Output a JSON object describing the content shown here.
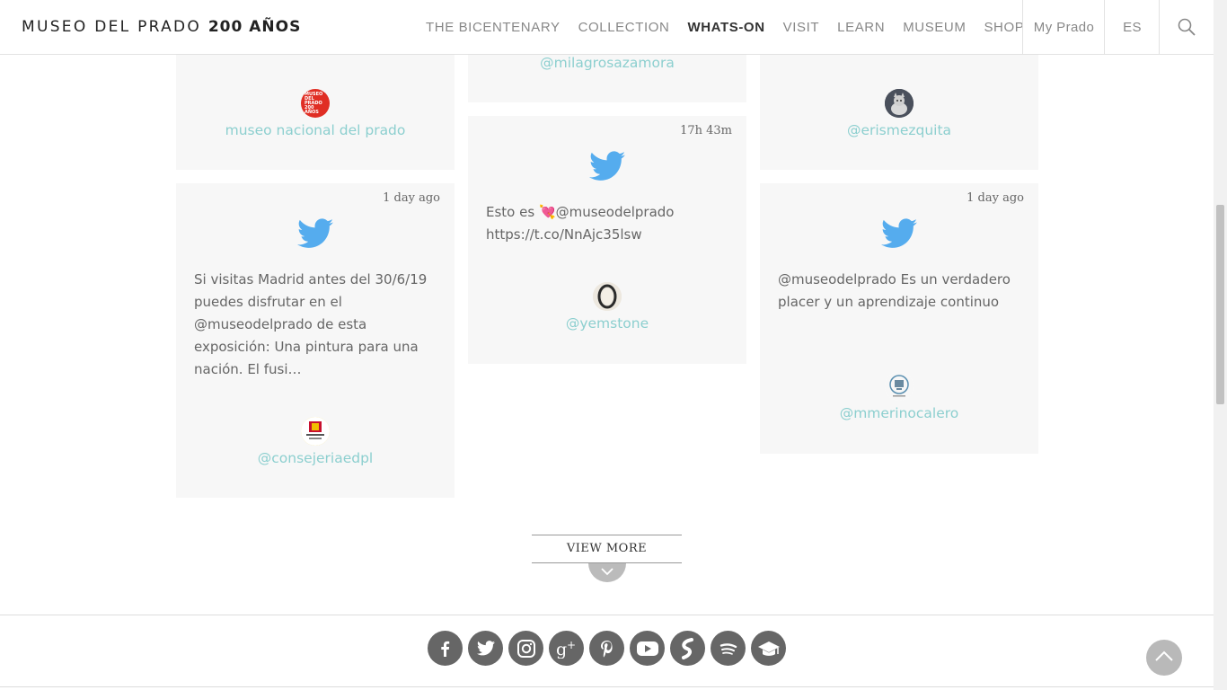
{
  "header": {
    "logo_text": "MUSEO DEL PRADO",
    "logo_bold": "200 AÑOS",
    "nav": [
      "THE BICENTENARY",
      "COLLECTION",
      "WHATS-ON",
      "VISIT",
      "LEARN",
      "MUSEUM",
      "SHOP"
    ],
    "active_nav": "WHATS-ON",
    "my_prado": "My Prado",
    "language": "ES"
  },
  "cards": {
    "c1": {
      "handle": "museo nacional del prado",
      "avatar_text": "MUSEO DEL PRADO 200 AÑOS"
    },
    "c2": {
      "handle": "@milagrosazamora"
    },
    "c3": {
      "handle": "@erismezquita"
    },
    "c4": {
      "time": "1 day ago",
      "text": "Si visitas Madrid antes del 30/6/19 puedes disfrutar en el @museodelprado de esta exposición: Una pintura para una nación. El fusi…",
      "handle": "@consejeriaedpl"
    },
    "c5": {
      "time": "17h 43m",
      "text_prefix": "Esto es ",
      "text_emoji": "💘",
      "text_rest": "@museodelprado https://t.co/NnAjc35lsw",
      "handle": "@yemstone"
    },
    "c6": {
      "time": "1 day ago",
      "text": "@museodelprado Es un verdadero placer y un aprendizaje continuo",
      "handle": "@mmerinocalero"
    }
  },
  "view_more": "VIEW MORE",
  "social_icons": [
    "facebook-icon",
    "twitter-icon",
    "instagram-icon",
    "google-plus-icon",
    "pinterest-icon",
    "youtube-icon",
    "soundcloud-icon",
    "spotify-icon",
    "education-icon"
  ],
  "colors": {
    "handle": "#8ccfcf",
    "twitter": "#55acee",
    "social": "#666666"
  }
}
